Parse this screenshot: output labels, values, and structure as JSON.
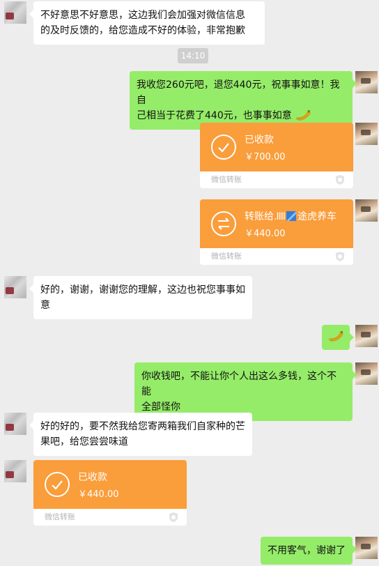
{
  "colors": {
    "background": "#ededed",
    "green_bubble": "#95ec69",
    "transfer_orange": "#fa9d3b",
    "white": "#ffffff"
  },
  "timestamp": "14:10",
  "messages": {
    "m1": {
      "line1": "不好意思不好意思，这边我们会加强对微信信息",
      "line2": "的及时反馈的，给您造成不好的体验，非常抱歉"
    },
    "m2": {
      "line1": "我收您260元吧，退您440元，祝事事如意！我自",
      "line2": "己相当于花费了440元，也事事如意",
      "emoji": "banana-icon"
    },
    "m3": {
      "status": "已收款",
      "amount": "￥700.00",
      "footer": "微信转账"
    },
    "m4": {
      "status_prefix": "转账给",
      "status_suffix": "途虎养车",
      "amount": "￥440.00",
      "footer": "微信转账"
    },
    "m5": {
      "line1": "好的，谢谢，谢谢您的理解，这边也祝您事事如",
      "line2": "意"
    },
    "m6": {
      "emoji": "banana-icon"
    },
    "m7": {
      "line1": "你收钱吧，不能让你个人出这么多钱，这个不能",
      "line2": "全部怪你"
    },
    "m8": {
      "line1": "好的好的，要不然我给您寄两箱我们自家种的芒",
      "line2": "果吧，给您尝尝味道"
    },
    "m9": {
      "status": "已收款",
      "amount": "￥440.00",
      "footer": "微信转账"
    },
    "m10": {
      "text": "不用客气，谢谢了"
    }
  }
}
